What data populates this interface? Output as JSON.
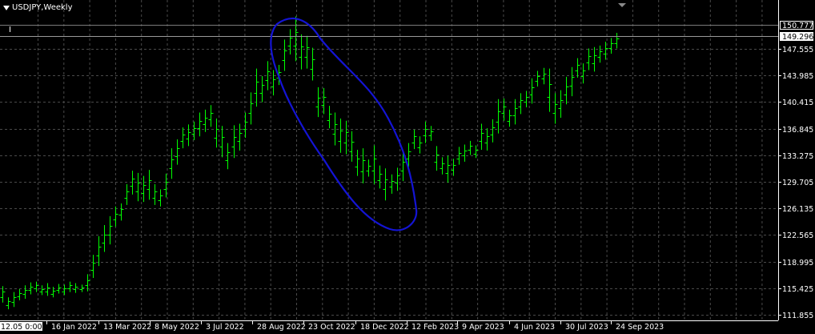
{
  "header": {
    "symbol_title": "USDJPY,Weekly"
  },
  "price_tags": {
    "high": "150.777",
    "current": "149.296"
  },
  "price_axis": [
    "147.555",
    "143.985",
    "140.415",
    "136.845",
    "133.275",
    "129.705",
    "126.135",
    "122.565",
    "118.995",
    "115.425",
    "111.855"
  ],
  "time_axis": [
    "12.05 0:00",
    "16 Jan 2022",
    "13 Mar 2022",
    "8 May 2022",
    "3 Jul 2022",
    "28 Aug 2022",
    "23 Oct 2022",
    "18 Dec 2022",
    "12 Feb 2023",
    "9 Apr 2023",
    "4 Jun 2023",
    "30 Jul 2023",
    "24 Sep 2023"
  ],
  "colors": {
    "background": "#000000",
    "bars": "#00ff00",
    "grid": "#3a3a3a",
    "axis_text": "#ffffff",
    "annotation": "#1414d4"
  },
  "icons": {
    "dropdown": "triangle-down-icon"
  },
  "chart_data": {
    "type": "ohlc",
    "title": "USDJPY,Weekly",
    "ylim": [
      111.855,
      150.777
    ],
    "bars": [
      [
        115.7,
        113.5
      ],
      [
        114.2,
        112.6
      ],
      [
        114.9,
        112.9
      ],
      [
        115.3,
        113.8
      ],
      [
        115.8,
        114.0
      ],
      [
        116.2,
        114.6
      ],
      [
        116.3,
        114.9
      ],
      [
        115.8,
        114.5
      ],
      [
        116.1,
        114.4
      ],
      [
        115.6,
        114.2
      ],
      [
        116.0,
        114.7
      ],
      [
        115.9,
        114.5
      ],
      [
        116.3,
        114.9
      ],
      [
        116.1,
        114.8
      ],
      [
        115.9,
        114.9
      ],
      [
        117.3,
        115.0
      ],
      [
        119.9,
        116.8
      ],
      [
        122.4,
        118.4
      ],
      [
        123.9,
        120.3
      ],
      [
        125.1,
        121.3
      ],
      [
        126.4,
        123.7
      ],
      [
        126.8,
        124.5
      ],
      [
        129.4,
        126.6
      ],
      [
        131.2,
        128.0
      ],
      [
        130.9,
        127.1
      ],
      [
        130.5,
        127.0
      ],
      [
        131.3,
        127.3
      ],
      [
        129.4,
        126.6
      ],
      [
        128.7,
        126.4
      ],
      [
        130.8,
        127.6
      ],
      [
        134.2,
        130.1
      ],
      [
        135.4,
        132.0
      ],
      [
        137.0,
        134.2
      ],
      [
        137.4,
        134.5
      ],
      [
        137.8,
        135.3
      ],
      [
        139.0,
        135.8
      ],
      [
        139.4,
        136.4
      ],
      [
        140.0,
        137.1
      ],
      [
        138.2,
        134.3
      ],
      [
        137.2,
        133.0
      ],
      [
        134.9,
        131.4
      ],
      [
        137.3,
        132.9
      ],
      [
        137.5,
        133.9
      ],
      [
        139.0,
        135.6
      ],
      [
        141.7,
        137.4
      ],
      [
        144.9,
        139.8
      ],
      [
        143.9,
        140.4
      ],
      [
        145.9,
        142.0
      ],
      [
        144.7,
        141.3
      ],
      [
        145.4,
        142.7
      ],
      [
        148.8,
        144.6
      ],
      [
        150.2,
        146.8
      ],
      [
        151.9,
        145.9
      ],
      [
        149.5,
        144.8
      ],
      [
        149.3,
        144.9
      ],
      [
        147.7,
        143.3
      ],
      [
        142.4,
        138.4
      ],
      [
        142.3,
        138.8
      ],
      [
        139.9,
        136.9
      ],
      [
        139.0,
        134.6
      ],
      [
        138.2,
        133.6
      ],
      [
        137.9,
        133.4
      ],
      [
        136.5,
        132.4
      ],
      [
        134.0,
        130.5
      ],
      [
        134.2,
        129.5
      ],
      [
        132.7,
        130.4
      ],
      [
        134.6,
        129.4
      ],
      [
        131.9,
        128.8
      ],
      [
        131.5,
        127.2
      ],
      [
        130.7,
        128.1
      ],
      [
        131.6,
        128.5
      ],
      [
        133.8,
        129.8
      ],
      [
        134.9,
        131.7
      ],
      [
        136.7,
        134.1
      ],
      [
        135.8,
        133.5
      ],
      [
        137.8,
        134.9
      ],
      [
        137.2,
        135.2
      ],
      [
        134.5,
        131.2
      ],
      [
        133.0,
        130.7
      ],
      [
        133.2,
        129.6
      ],
      [
        132.8,
        130.5
      ],
      [
        134.4,
        132.0
      ],
      [
        134.7,
        132.4
      ],
      [
        135.2,
        133.3
      ],
      [
        134.6,
        132.9
      ],
      [
        137.5,
        134.0
      ],
      [
        136.9,
        133.9
      ],
      [
        138.1,
        135.0
      ],
      [
        140.8,
        136.2
      ],
      [
        140.9,
        137.9
      ],
      [
        139.4,
        137.1
      ],
      [
        140.8,
        137.4
      ],
      [
        141.6,
        138.8
      ],
      [
        141.9,
        139.7
      ],
      [
        143.6,
        140.2
      ],
      [
        144.6,
        142.5
      ],
      [
        145.0,
        142.8
      ],
      [
        144.9,
        139.1
      ],
      [
        141.6,
        137.5
      ],
      [
        142.0,
        138.3
      ],
      [
        143.8,
        140.1
      ],
      [
        145.1,
        141.2
      ],
      [
        146.3,
        143.7
      ],
      [
        145.6,
        142.9
      ],
      [
        147.6,
        144.7
      ],
      [
        147.8,
        144.5
      ],
      [
        148.0,
        145.7
      ],
      [
        148.5,
        146.1
      ],
      [
        149.0,
        146.9
      ],
      [
        149.7,
        147.6
      ]
    ]
  }
}
